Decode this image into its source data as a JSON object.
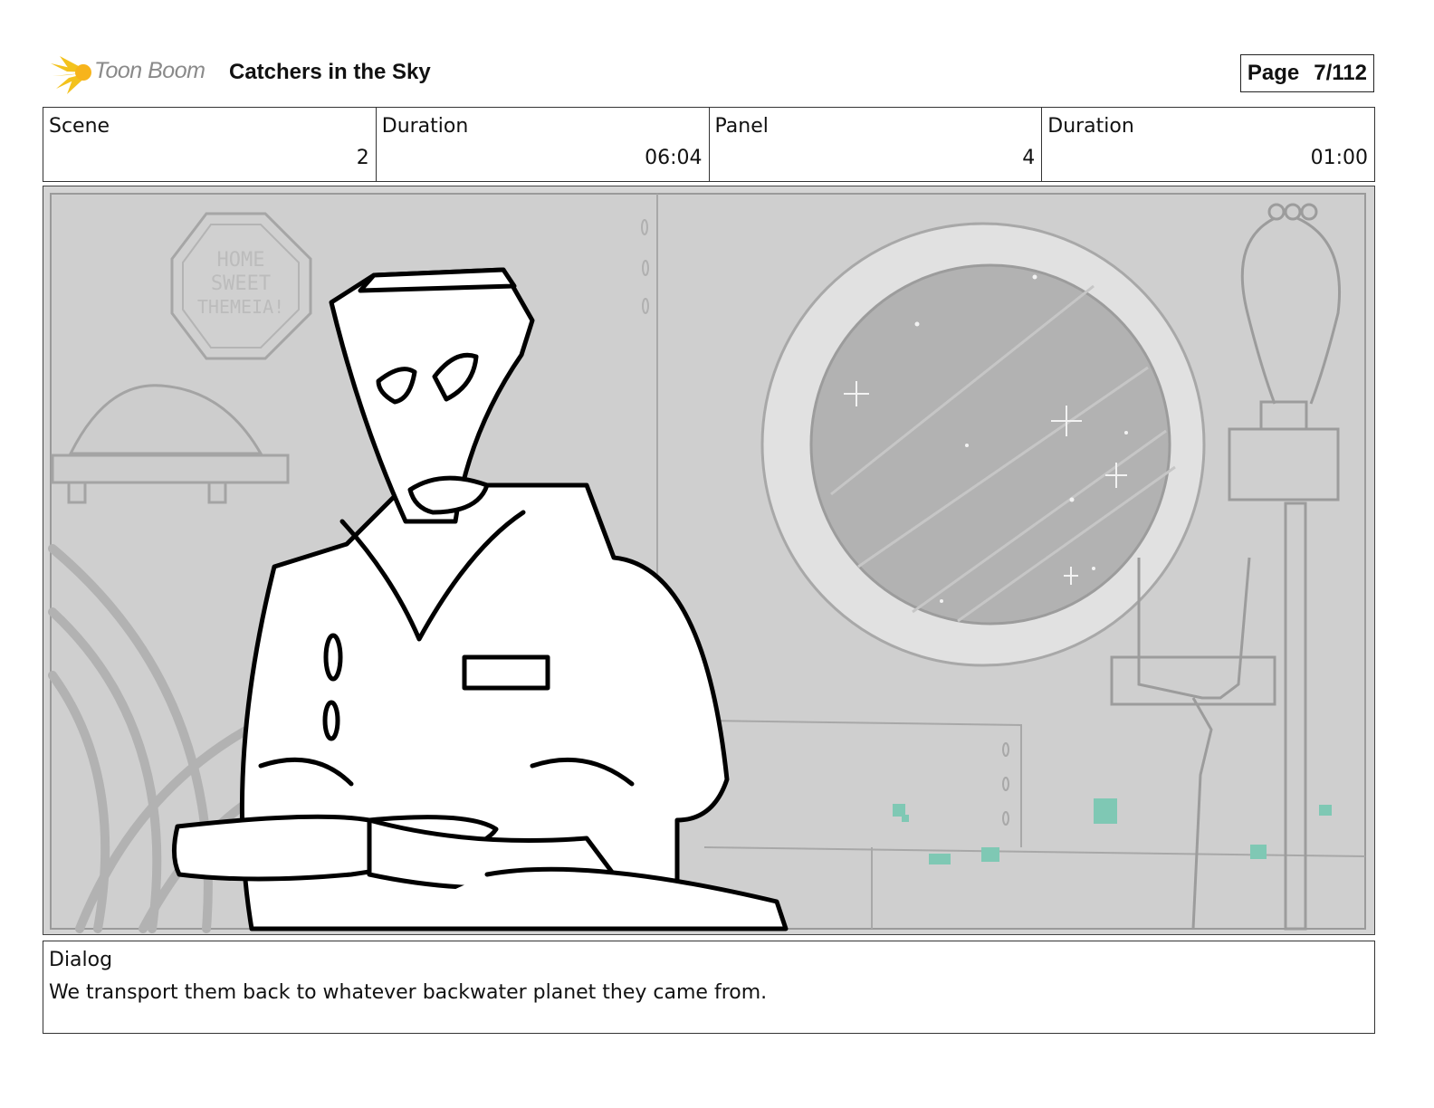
{
  "header": {
    "logo_text": "Toon Boom",
    "project_title": "Catchers in the Sky",
    "page_label": "Page",
    "page_value": "7/112"
  },
  "info": {
    "scene_label": "Scene",
    "scene_value": "2",
    "scene_duration_label": "Duration",
    "scene_duration_value": "06:04",
    "panel_label": "Panel",
    "panel_value": "4",
    "panel_duration_label": "Duration",
    "panel_duration_value": "01:00"
  },
  "panel": {
    "sign_lines": [
      "HOME",
      "SWEET",
      "THEMEIA!"
    ],
    "accent_color": "#7fc8b4"
  },
  "dialog": {
    "label": "Dialog",
    "text": "We transport them back to whatever backwater planet they came from."
  }
}
